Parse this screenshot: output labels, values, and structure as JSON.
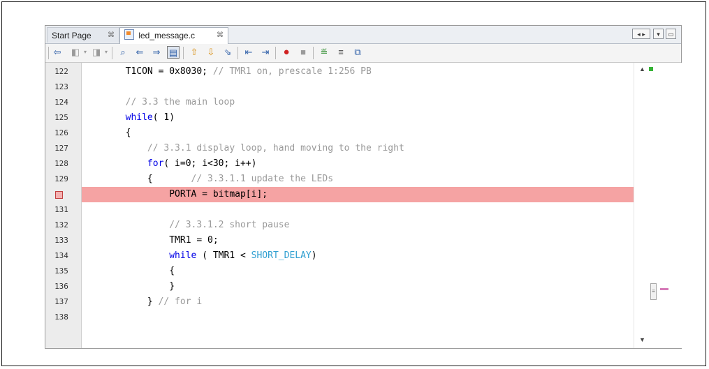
{
  "tabs": [
    {
      "label": "Start Page",
      "close": "⌘",
      "active": false
    },
    {
      "label": "led_message.c",
      "close": "⌘",
      "active": true
    }
  ],
  "window_controls": [
    "◂ ▸",
    "▾",
    "▭"
  ],
  "toolbar": [
    "history-back-icon",
    "toggle-bookmark-icon",
    "dropdown-icon",
    "forward-history-icon",
    "dropdown-icon",
    "find-selection-icon",
    "find-previous-icon",
    "find-next-icon",
    "toggle-highlight-icon",
    "previous-bookmark-icon",
    "next-bookmark-icon",
    "toggle-bookmark-icon",
    "shift-left-icon",
    "shift-right-icon",
    "start-macro-icon",
    "stop-macro-icon",
    "comment-icon",
    "uncomment-icon",
    "diff-icon"
  ],
  "editor": {
    "lines": [
      {
        "num": "122",
        "parts": [
          {
            "t": "        T1CON = 0x8030; ",
            "c": ""
          },
          {
            "t": "// TMR1 on, prescale 1:256 PB",
            "c": "cm"
          }
        ]
      },
      {
        "num": "123",
        "parts": []
      },
      {
        "num": "124",
        "parts": [
          {
            "t": "        ",
            "c": ""
          },
          {
            "t": "// 3.3 the main loop",
            "c": "cm"
          }
        ]
      },
      {
        "num": "125",
        "parts": [
          {
            "t": "        ",
            "c": ""
          },
          {
            "t": "while",
            "c": "kw"
          },
          {
            "t": "( 1)",
            "c": ""
          }
        ]
      },
      {
        "num": "126",
        "parts": [
          {
            "t": "        {",
            "c": ""
          }
        ]
      },
      {
        "num": "127",
        "parts": [
          {
            "t": "            ",
            "c": ""
          },
          {
            "t": "// 3.3.1 display loop, hand moving to the right",
            "c": "cm"
          }
        ]
      },
      {
        "num": "128",
        "parts": [
          {
            "t": "            ",
            "c": ""
          },
          {
            "t": "for",
            "c": "kw"
          },
          {
            "t": "( i=0; i<30; i++)",
            "c": ""
          }
        ]
      },
      {
        "num": "129",
        "parts": [
          {
            "t": "            {       ",
            "c": ""
          },
          {
            "t": "// 3.3.1.1 update the LEDs",
            "c": "cm"
          }
        ]
      },
      {
        "num": "",
        "breakpoint": true,
        "highlight": true,
        "parts": [
          {
            "t": "                PORTA = bitmap[i];",
            "c": ""
          }
        ]
      },
      {
        "num": "131",
        "parts": []
      },
      {
        "num": "132",
        "parts": [
          {
            "t": "                ",
            "c": ""
          },
          {
            "t": "// 3.3.1.2 short pause",
            "c": "cm"
          }
        ]
      },
      {
        "num": "133",
        "parts": [
          {
            "t": "                TMR1 = 0;",
            "c": ""
          }
        ]
      },
      {
        "num": "134",
        "parts": [
          {
            "t": "                ",
            "c": ""
          },
          {
            "t": "while",
            "c": "kw"
          },
          {
            "t": " ( TMR1 < ",
            "c": ""
          },
          {
            "t": "SHORT_DELAY",
            "c": "const"
          },
          {
            "t": ")",
            "c": ""
          }
        ]
      },
      {
        "num": "135",
        "parts": [
          {
            "t": "                {",
            "c": ""
          }
        ]
      },
      {
        "num": "136",
        "parts": [
          {
            "t": "                }",
            "c": ""
          }
        ]
      },
      {
        "num": "137",
        "parts": [
          {
            "t": "            } ",
            "c": ""
          },
          {
            "t": "// for i",
            "c": "cm"
          }
        ]
      },
      {
        "num": "138",
        "parts": []
      }
    ]
  },
  "colors": {
    "highlight_line": "#f5a3a3",
    "keyword": "#0000e6",
    "comment": "#9a9a9a",
    "constant": "#2f9fd1"
  }
}
